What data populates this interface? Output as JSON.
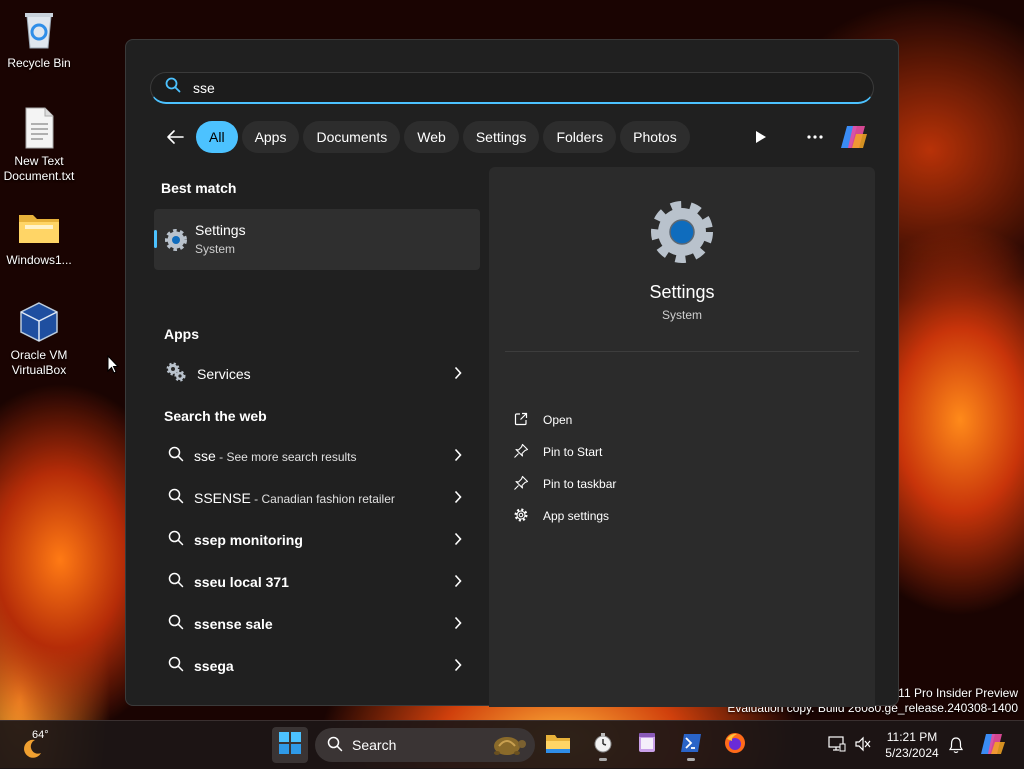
{
  "desktop": {
    "icons": [
      {
        "label": "Recycle Bin",
        "icon": "recycle-bin-icon"
      },
      {
        "label": "New Text Document.txt",
        "icon": "text-file-icon"
      },
      {
        "label": "Windows1...",
        "icon": "folder-icon"
      },
      {
        "label": "Oracle VM VirtualBox",
        "icon": "virtualbox-icon"
      }
    ],
    "watermark_line1": "11 Pro Insider Preview",
    "watermark_line2": "Evaluation copy. Build 26080.ge_release.240308-1400"
  },
  "search": {
    "query": "sse"
  },
  "filters": {
    "back_icon": "back-arrow-icon",
    "chips": [
      "All",
      "Apps",
      "Documents",
      "Web",
      "Settings",
      "Folders",
      "Photos"
    ],
    "active": "All",
    "play_icon": "play-icon",
    "more_icon": "more-icon",
    "copilot_icon": "copilot-icon"
  },
  "results": {
    "best_match_title": "Best match",
    "best_match": {
      "name": "Settings",
      "subtitle": "System",
      "icon": "gear-icon"
    },
    "apps_title": "Apps",
    "apps": [
      {
        "name": "Services",
        "icon": "services-icon"
      }
    ],
    "web_title": "Search the web",
    "web": [
      {
        "bold": "sse",
        "rest": " - See more search results"
      },
      {
        "bold": "SSENSE",
        "rest": " - Canadian fashion retailer"
      },
      {
        "bold": "ssep monitoring",
        "rest": ""
      },
      {
        "bold": "sseu local 371",
        "rest": ""
      },
      {
        "bold": "ssense sale",
        "rest": ""
      },
      {
        "bold": "ssega",
        "rest": ""
      }
    ]
  },
  "preview": {
    "title": "Settings",
    "subtitle": "System",
    "actions": [
      {
        "label": "Open",
        "icon": "open-external-icon"
      },
      {
        "label": "Pin to Start",
        "icon": "pin-icon"
      },
      {
        "label": "Pin to taskbar",
        "icon": "pin-icon"
      },
      {
        "label": "App settings",
        "icon": "gear-icon"
      }
    ]
  },
  "taskbar": {
    "weather_temp": "64°",
    "search_label": "Search",
    "clock_time": "11:21 PM",
    "clock_date": "5/23/2024",
    "apps": [
      "start-icon",
      "file-explorer-icon",
      "clock-app-icon",
      "notepad-icon",
      "powershell-icon",
      "firefox-icon"
    ]
  },
  "colors": {
    "accent": "#4cc2ff",
    "panel_bg": "#202020",
    "preview_bg": "#2b2b2b",
    "selected_row": "#2f2f2f"
  }
}
